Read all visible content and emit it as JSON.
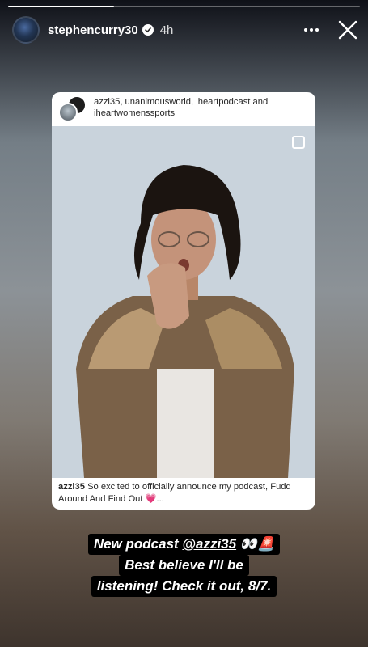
{
  "story": {
    "progress_fraction": 0.3,
    "username": "stephencurry30",
    "time_ago": "4h",
    "icons": {
      "verified": "verified-badge-icon",
      "more": "more-options-icon",
      "close": "close-icon"
    }
  },
  "post": {
    "collaborators": "azzi35, unanimousworld, iheartpodcast",
    "collab_and": " and ",
    "collab_last": "iheartwomenssports",
    "caption_user": "azzi35",
    "caption_text": " So excited to officially announce my podcast, Fudd Around And Find Out ",
    "caption_emoji": "💗",
    "caption_more": "...",
    "icons": {
      "multi": "multi-photo-icon"
    }
  },
  "overlay": {
    "line1_prefix": "New podcast ",
    "line1_mention": "@azzi35",
    "line1_suffix": " 👀🚨",
    "line2": "Best believe I'll be",
    "line3": "listening! Check it out, 8/7."
  },
  "colors": {
    "brand_white": "#ffffff",
    "overlay_bg": "#000000",
    "heart": "#e8508c"
  }
}
